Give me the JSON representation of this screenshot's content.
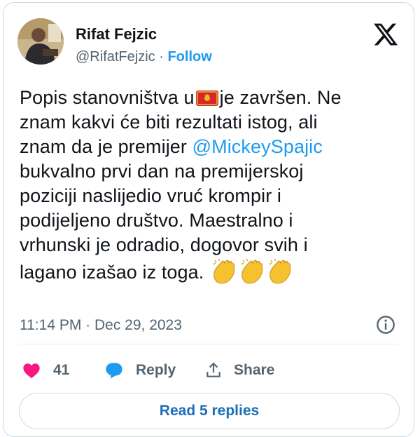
{
  "author": {
    "name": "Rifat Fejzic",
    "handle": "@RifatFejzic",
    "separator": "·",
    "follow_label": "Follow"
  },
  "tweet": {
    "line1_before_flag": "Popis stanovništva u",
    "line1_after_flag": "je završen. Ne",
    "line2": "znam kakvi će biti rezultati istog, ali",
    "line3_before_mention": "znam da je premijer ",
    "mention": "@MickeySpajic",
    "line4": "bukvalno prvi dan na premijerskoj",
    "line5": "poziciji naslijedio vruć krompir i",
    "line6": "podijeljeno društvo. Maestralno i",
    "line7": "vrhunski je odradio, dogovor svih i",
    "line8": "lagano izašao iz toga.",
    "flag_icon": "montenegro-flag-icon",
    "emoji_icon": "clapping-hands-icon",
    "emoji_count": 3
  },
  "timestamp": "11:14 PM · Dec 29, 2023",
  "actions": {
    "like_count": "41",
    "reply_label": "Reply",
    "share_label": "Share"
  },
  "replies_button": "Read 5 replies",
  "colors": {
    "accent": "#1d9bf0",
    "like": "#f91880",
    "muted": "#536471",
    "border": "#cfd9de"
  }
}
